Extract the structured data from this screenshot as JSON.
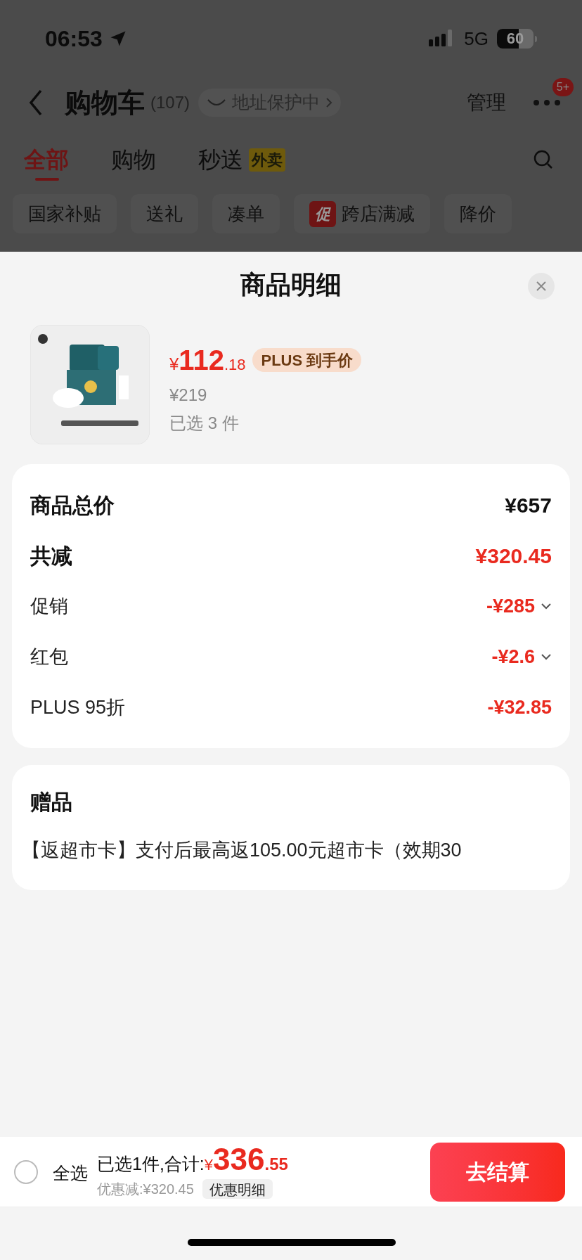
{
  "status_bar": {
    "time": "06:53",
    "network": "5G",
    "battery": "60"
  },
  "header": {
    "title": "购物车",
    "count": "(107)",
    "address_badge": "地址保护中",
    "manage": "管理",
    "more_badge": "5+"
  },
  "tabs": [
    {
      "label": "全部",
      "selected": true
    },
    {
      "label": "购物",
      "selected": false
    },
    {
      "label": "秒送",
      "selected": false,
      "tag": "外卖"
    }
  ],
  "filters": [
    {
      "label": "国家补贴"
    },
    {
      "label": "送礼"
    },
    {
      "label": "凑单"
    },
    {
      "label": "跨店满减",
      "tag": "促"
    },
    {
      "label": "降价"
    }
  ],
  "sheet": {
    "title": "商品明细",
    "product": {
      "price_symbol": "¥",
      "price_int": "112",
      "price_dec": ".18",
      "price_tag": "PLUS 到手价",
      "original_price": "¥219",
      "quantity": "已选 3 件"
    },
    "summary": [
      {
        "label": "商品总价",
        "value": "¥657",
        "kind": "total"
      },
      {
        "label": "共减",
        "value": "¥320.45",
        "kind": "discount_total"
      },
      {
        "label": "促销",
        "value": "-¥285",
        "kind": "item",
        "expandable": true
      },
      {
        "label": "红包",
        "value": "-¥2.6",
        "kind": "item",
        "expandable": true
      },
      {
        "label": "PLUS 95折",
        "value": "-¥32.85",
        "kind": "item",
        "expandable": false
      }
    ],
    "gift": {
      "title": "赠品",
      "text": "【返超市卡】支付后最高返105.00元超市卡（效期30"
    }
  },
  "bottom_bar": {
    "select_all": "全选",
    "checked": false,
    "selected_text": "已选1件,合计:",
    "total_symbol": "¥",
    "total_int": "336",
    "total_dec": ".55",
    "saving": "优惠减:¥320.45",
    "detail_button": "优惠明细",
    "checkout": "去结算"
  }
}
